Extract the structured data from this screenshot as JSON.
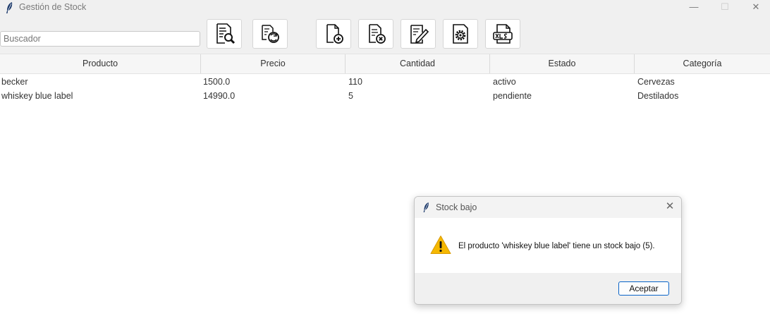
{
  "window": {
    "title": "Gestión de Stock",
    "controls": {
      "minimize": "—",
      "maximize": "☐",
      "close": "✕"
    }
  },
  "toolbar": {
    "search": {
      "value": "",
      "placeholder": "Buscador"
    },
    "buttons": [
      {
        "icon": "search-document-icon"
      },
      {
        "icon": "refresh-document-icon"
      },
      {
        "icon": "add-document-icon"
      },
      {
        "icon": "delete-document-icon"
      },
      {
        "icon": "edit-document-icon"
      },
      {
        "icon": "settings-document-icon"
      },
      {
        "icon": "xls-export-icon"
      }
    ]
  },
  "table": {
    "columns": [
      "Producto",
      "Precio",
      "Cantidad",
      "Estado",
      "Categoría"
    ],
    "rows": [
      [
        "becker",
        "1500.0",
        "110",
        "activo",
        "Cervezas"
      ],
      [
        "whiskey blue label",
        "14990.0",
        "5",
        "pendiente",
        "Destilados"
      ]
    ]
  },
  "dialog": {
    "title": "Stock bajo",
    "close": "✕",
    "message": "El producto 'whiskey blue label' tiene un stock bajo (5).",
    "icon": "warning-icon",
    "ok_label": "Aceptar"
  },
  "colors": {
    "accent": "#0a64c8",
    "warning": "#f5b800"
  }
}
